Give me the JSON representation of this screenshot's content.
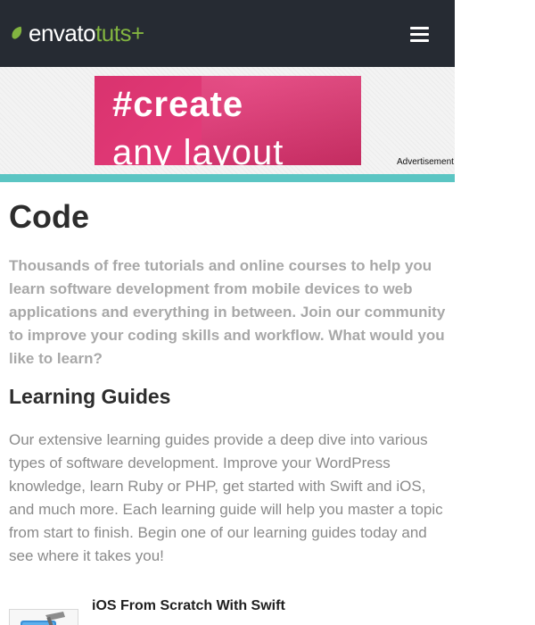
{
  "header": {
    "logo_primary": "envato",
    "logo_secondary": "tuts+",
    "menu_icon": "hamburger-menu-icon"
  },
  "ad": {
    "line1": "#create",
    "line2": "any layout",
    "label": "Advertisement",
    "choices_icons": [
      "adchoices-play-icon",
      "close-icon"
    ]
  },
  "page": {
    "title": "Code",
    "intro": "Thousands of free tutorials and online courses to help you learn software development from mobile devices to web applications and everything in between. Join our community to improve your coding skills and workflow. What would you like to learn?"
  },
  "learning_guides": {
    "title": "Learning Guides",
    "description": "Our extensive learning guides provide a deep dive into various types of software development. Improve your WordPress knowledge, learn Ruby or PHP, get started with Swift and iOS, and much more. Each learning guide will help you master a topic from start to finish. Begin one of our learning guides today and see where it takes you!",
    "items": [
      {
        "title": "iOS From Scratch With Swift",
        "thumb_icon": "xcode-hammer-icon"
      }
    ]
  },
  "colors": {
    "header_bg": "#262b33",
    "brand_green": "#82b440",
    "ad_pink": "#d9336e",
    "accent_teal": "#5bc5c3"
  }
}
